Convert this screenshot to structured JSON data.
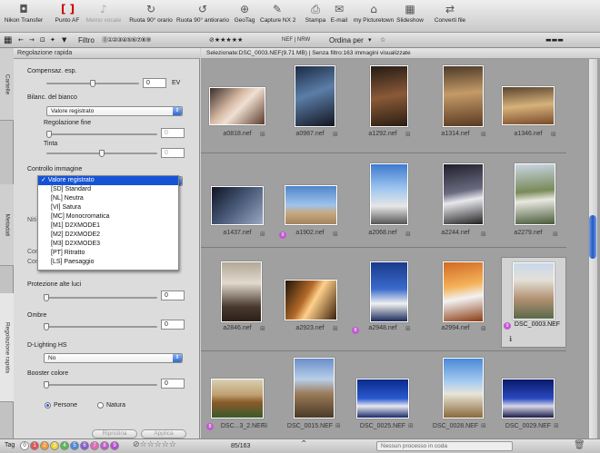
{
  "toolbar": {
    "items": [
      {
        "label": "Nikon Transfer",
        "icon": "camera-icon"
      },
      {
        "label": "Punto AF",
        "icon": "af-point-icon"
      },
      {
        "label": "Memo vocale",
        "icon": "voice-memo-icon"
      },
      {
        "label": "Ruota 90° orario",
        "icon": "rotate-cw-icon"
      },
      {
        "label": "Ruota 90° antiorario",
        "icon": "rotate-ccw-icon"
      },
      {
        "label": "GeoTag",
        "icon": "geotag-icon"
      },
      {
        "label": "Capture NX 2",
        "icon": "capture-nx-icon"
      },
      {
        "label": "Stampa",
        "icon": "print-icon"
      },
      {
        "label": "E-mail",
        "icon": "email-icon"
      },
      {
        "label": "my Picturetown",
        "icon": "picturetown-icon"
      },
      {
        "label": "Slideshow",
        "icon": "slideshow-icon"
      },
      {
        "label": "Converti file",
        "icon": "convert-icon"
      }
    ]
  },
  "filterbar": {
    "filter_label": "Filtro",
    "filetype": "NEF | NRW",
    "sort_label": "Ordina per"
  },
  "panel": {
    "title": "Regolazione rapida",
    "tabs": [
      "Cartelle",
      "Metadati",
      "Regolazione rapida"
    ],
    "exposure_label": "Compensaz. esp.",
    "exposure_value": "0",
    "exposure_unit": "EV",
    "wb_label": "Bilanc. del bianco",
    "wb_value": "Valore registrato",
    "fine_label": "Regolazione fine",
    "fine_value": "0",
    "tint_label": "Tinta",
    "tint_value": "0",
    "picture_control_label": "Controllo immagine",
    "partial_labels": [
      "Niti",
      "Con",
      "Con"
    ],
    "dropdown_items": [
      "✓ Valore registrato",
      "[SD] Standard",
      "[NL] Neutra",
      "[VI] Satura",
      "[MC] Monocromatica",
      "[M1] D2XMODE1",
      "[M2] D2XMODE2",
      "[M3] D2XMODE3",
      "[PT] Ritratto",
      "[LS] Paesaggio"
    ],
    "highlight_label": "Protezione alte luci",
    "highlight_value": "0",
    "shadow_label": "Ombre",
    "shadow_value": "0",
    "dlighting_label": "D-Lighting HS",
    "dlighting_value": "No",
    "booster_label": "Booster colore",
    "booster_value": "0",
    "radio_people": "Persone",
    "radio_nature": "Natura",
    "reset_label": "Ripristina",
    "apply_label": "Applica"
  },
  "status": {
    "text": "Selezionate:DSC_0003.NEF(9.71 MB) | Senza filtro:163 immagini visualizzate"
  },
  "rows": [
    [
      "a0818.nef",
      "a0987.nef",
      "a1292.nef",
      "a1314.nef",
      "a1346.nef"
    ],
    [
      "a1437.nef",
      "a1902.nef",
      "a2068.nef",
      "a2244.nef",
      "a2279.nef"
    ],
    [
      "a2846.nef",
      "a2923.nef",
      "a2948.nef",
      "a2994.nef",
      "DSC_0003.NEF"
    ],
    [
      "DSC...3_2.NEF",
      "DSC_0015.NEF",
      "DSC_0025.NEF",
      "DSC_0028.NEF",
      "DSC_0029.NEF"
    ]
  ],
  "badges": {
    "b1": "9",
    "b2": "8",
    "b3": "9",
    "b4": "8"
  },
  "bottom": {
    "tag_label": "Tag",
    "labels": [
      "0",
      "1",
      "2",
      "3",
      "4",
      "5",
      "6",
      "7",
      "8",
      "9"
    ],
    "counter": "85/163",
    "queue": "Nessun processo in coda"
  },
  "colors": {
    "accent": "#1553d6",
    "panel": "#dcdcdc",
    "grid": "#a0a0a0"
  }
}
